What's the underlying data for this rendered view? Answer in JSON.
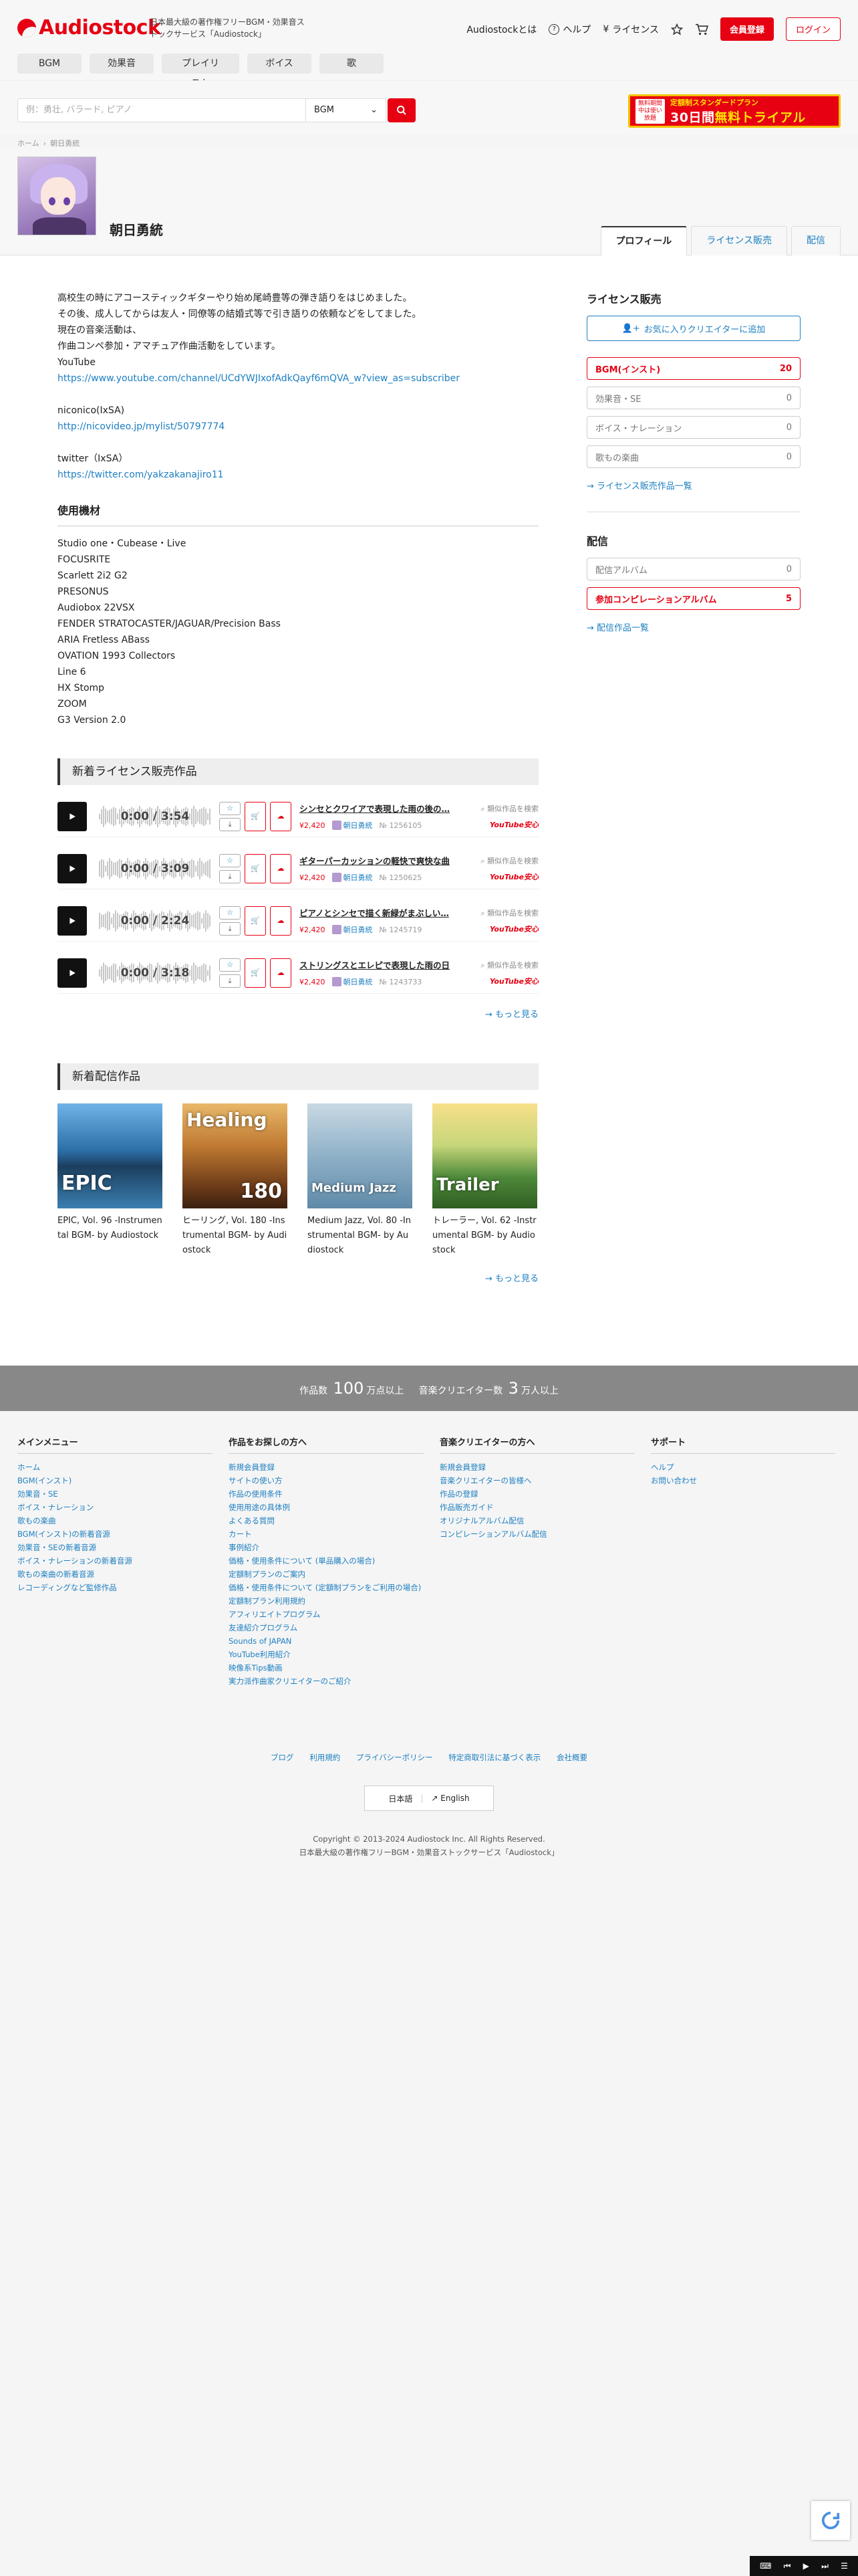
{
  "header": {
    "logo_main": "Audio",
    "logo_sub": "stock",
    "tagline": "日本最大級の著作権フリーBGM・効果音ストックサービス「Audiostock」",
    "nav_about": "Audiostockとは",
    "nav_help": "ヘルプ",
    "nav_license": "ライセンス",
    "register": "会員登録",
    "login": "ログイン",
    "categories": [
      "BGM",
      "効果音",
      "プレイリスト",
      "ボイス",
      "歌"
    ]
  },
  "search": {
    "placeholder": "例：勇壮, バラード, ピアノ",
    "select_value": "BGM"
  },
  "banner": {
    "badge": "無料期間中は使い放題",
    "line1": "定額制スタンダードプラン",
    "line2a": "30日間",
    "line2b": "無料トライアル"
  },
  "breadcrumb": [
    "ホーム",
    "朝日勇統"
  ],
  "profile": {
    "name": "朝日勇統",
    "tabs": [
      "プロフィール",
      "ライセンス販売",
      "配信"
    ]
  },
  "bio": [
    "高校生の時にアコースティックギターやり始め尾崎豊等の弾き語りをはじめました。",
    "その後、成人してからは友人・同僚等の結婚式等で引き語りの依頼などをしてました。",
    "現在の音楽活動は、",
    "作曲コンペ参加・アマチュア作曲活動をしています。",
    "YouTube",
    "https://www.youtube.com/channel/UCdYWJIxofAdkQayf6mQVA_w?view_as=subscriber",
    "",
    "niconico(IxSA)",
    "http://nicovideo.jp/mylist/50797774",
    "",
    "twitter（IxSA）",
    "https://twitter.com/yakzakanajiro11"
  ],
  "equipment": {
    "heading": "使用機材",
    "items": [
      "Studio one・Cubease・Live",
      "FOCUSRITE",
      "Scarlett 2i2 G2",
      "PRESONUS",
      "Audiobox 22VSX",
      "FENDER STRATOCASTER/JAGUAR/Precision Bass",
      "ARIA Fretless ABass",
      "OVATION 1993 Collectors",
      "Line 6",
      "HX Stomp",
      "ZOOM",
      "G3 Version 2.0"
    ]
  },
  "license_section": {
    "heading": "新着ライセンス販売作品",
    "tracks": [
      {
        "time": "0:00 / 3:54",
        "title": "シンセとクワイアで表現した雨の後の…",
        "price": "¥2,420",
        "author": "朝日勇統",
        "id": "№ 1256105",
        "similar": "類似作品を検索",
        "yt": "YouTube安心"
      },
      {
        "time": "0:00 / 3:09",
        "title": "ギターパーカッションの軽快で爽快な曲",
        "price": "¥2,420",
        "author": "朝日勇統",
        "id": "№ 1250625",
        "similar": "類似作品を検索",
        "yt": "YouTube安心"
      },
      {
        "time": "0:00 / 2:24",
        "title": "ピアノとシンセで描く新緑がまぶしい…",
        "price": "¥2,420",
        "author": "朝日勇統",
        "id": "№ 1245719",
        "similar": "類似作品を検索",
        "yt": "YouTube安心"
      },
      {
        "time": "0:00 / 3:18",
        "title": "ストリングスとエレピで表現した雨の日",
        "price": "¥2,420",
        "author": "朝日勇統",
        "id": "№ 1243733",
        "similar": "類似作品を検索",
        "yt": "YouTube安心"
      }
    ],
    "more": "もっと見る"
  },
  "distribution_section": {
    "heading": "新着配信作品",
    "albums": [
      {
        "cover_title": "EPIC",
        "cover_vol": "",
        "text": "EPIC, Vol. 96 -Instrumental BGM- by Audiostock"
      },
      {
        "cover_title": "Healing",
        "cover_vol": "180",
        "text": "ヒーリング, Vol. 180 -Instrumental BGM- by Audiostock"
      },
      {
        "cover_title": "Medium Jazz",
        "cover_vol": "",
        "text": "Medium Jazz, Vol. 80 -Instrumental BGM- by Audiostock"
      },
      {
        "cover_title": "Trailer",
        "cover_vol": "",
        "text": "トレーラー, Vol. 62 -Instrumental BGM- by Audiostock"
      }
    ],
    "more": "もっと見る"
  },
  "sidebar": {
    "license_heading": "ライセンス販売",
    "fav_button": "お気に入りクリエイターに追加",
    "license_items": [
      {
        "label": "BGM(インスト)",
        "count": "20"
      },
      {
        "label": "効果音・SE",
        "count": "0"
      },
      {
        "label": "ボイス・ナレーション",
        "count": "0"
      },
      {
        "label": "歌もの楽曲",
        "count": "0"
      }
    ],
    "license_link": "ライセンス販売作品一覧",
    "dist_heading": "配信",
    "dist_items": [
      {
        "label": "配信アルバム",
        "count": "0"
      },
      {
        "label": "参加コンピレーションアルバム",
        "count": "5"
      }
    ],
    "dist_link": "配信作品一覧"
  },
  "stats": {
    "label1": "作品数",
    "value1": "100",
    "unit1": "万点以上",
    "label2": "音楽クリエイター数",
    "value2": "3",
    "unit2": "万人以上"
  },
  "footer": {
    "col1": {
      "heading": "メインメニュー",
      "links": [
        "ホーム",
        "BGM(インスト)",
        "効果音・SE",
        "ボイス・ナレーション",
        "歌もの楽曲",
        "BGM(インスト)の新着音源",
        "効果音・SEの新着音源",
        "ボイス・ナレーションの新着音源",
        "歌もの楽曲の新着音源",
        "レコーディングなど監修作品"
      ]
    },
    "col2": {
      "heading": "作品をお探しの方へ",
      "links": [
        "新規会員登録",
        "サイトの使い方",
        "作品の使用条件",
        "使用用途の具体例",
        "よくある質問",
        "カート",
        "事例紹介",
        "価格・使用条件について (単品購入の場合)",
        "定額制プランのご案内",
        "価格・使用条件について (定額制プランをご利用の場合)",
        "定額制プラン利用規約",
        "アフィリエイトプログラム",
        "友達紹介プログラム",
        "Sounds of JAPAN",
        "YouTube利用紹介",
        "映像系Tips動画",
        "実力派作曲家クリエイターのご紹介"
      ]
    },
    "col3": {
      "heading": "音楽クリエイターの方へ",
      "links": [
        "新規会員登録",
        "音楽クリエイターの皆様へ",
        "作品の登録",
        "作品販売ガイド",
        "オリジナルアルバム配信",
        "コンピレーションアルバム配信"
      ]
    },
    "col4": {
      "heading": "サポート",
      "links": [
        "ヘルプ",
        "お問い合わせ"
      ]
    },
    "bottom_links": [
      "ブログ",
      "利用規約",
      "プライバシーポリシー",
      "特定商取引法に基づく表示",
      "会社概要"
    ],
    "lang_ja": "日本語",
    "lang_en": "English",
    "copyright": "Copyright © 2013-2024 Audiostock Inc. All Rights Reserved.",
    "copyright2": "日本最大級の著作権フリーBGM・効果音ストックサービス「Audiostock」"
  },
  "colors": {
    "accent": "#e60012",
    "link": "#1d7fc1"
  }
}
